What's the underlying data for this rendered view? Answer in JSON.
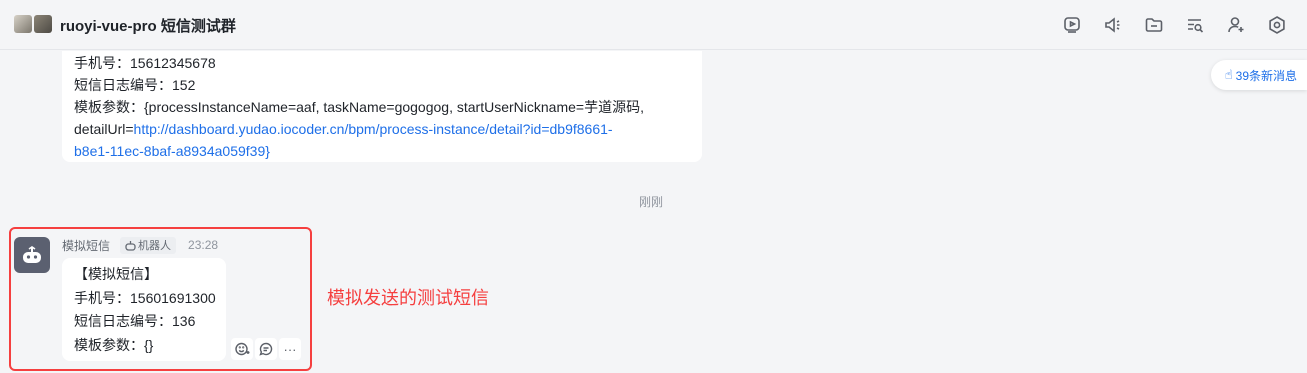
{
  "header": {
    "title": "ruoyi-vue-pro 短信测试群",
    "toolbar_icons": [
      "video-play-icon",
      "speaker-icon",
      "folder-icon",
      "search-list-icon",
      "add-member-icon",
      "settings-icon"
    ]
  },
  "previous_message": {
    "lines": [
      "手机号：15612345678",
      "短信日志编号：152",
      "模板参数：{processInstanceName=aaf, taskName=gogogog, startUserNickname=芋道源码,"
    ],
    "detail_prefix": "detailUrl=",
    "link_part1": "http://dashboard.yudao.iocoder.cn/bpm/process-instance/detail?id=db9f8661-",
    "link_part2": "b8e1-11ec-8baf-a8934a059f39}"
  },
  "new_messages_badge": "39条新消息",
  "time_divider": "刚刚",
  "message": {
    "sender": "模拟短信",
    "bot_tag": "机器人",
    "time": "23:28",
    "lines": [
      "【模拟短信】",
      "手机号：15601691300",
      "短信日志编号：136",
      "模板参数：{}"
    ],
    "actions": [
      "add-reaction-icon",
      "reply-icon",
      "more-icon"
    ],
    "more_label": "···"
  },
  "annotation": "模拟发送的测试短信",
  "colors": {
    "accent_link": "#1e6fe8",
    "annotation_red": "#f53f3f",
    "background": "#f4f5f7"
  }
}
